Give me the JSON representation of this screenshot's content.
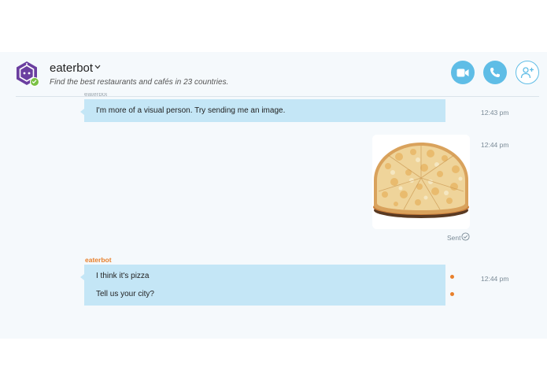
{
  "header": {
    "bot_name": "eaterbot",
    "subtitle": "Find the best restaurants and cafés in 23 countries.",
    "status_color": "#7ac143",
    "avatar_color": "#6b3fa0",
    "buttons": {
      "video_icon": "video-camera-icon",
      "call_icon": "phone-icon",
      "add_contact_icon": "add-person-icon"
    }
  },
  "messages": [
    {
      "type": "incoming",
      "sender": "eaterbot",
      "text": "I'm more of a visual person. Try sending me an image.",
      "time": "12:43 pm"
    },
    {
      "type": "outgoing-image",
      "image_subject": "pizza",
      "time": "12:44 pm",
      "status": "Sent"
    },
    {
      "type": "incoming",
      "sender": "eaterbot",
      "lines": [
        "I think it's pizza",
        "Tell us your city?"
      ],
      "time": "12:44 pm"
    }
  ],
  "colors": {
    "accent": "#5fbde6",
    "bubble": "#c4e6f6",
    "sender": "#e8802c"
  }
}
